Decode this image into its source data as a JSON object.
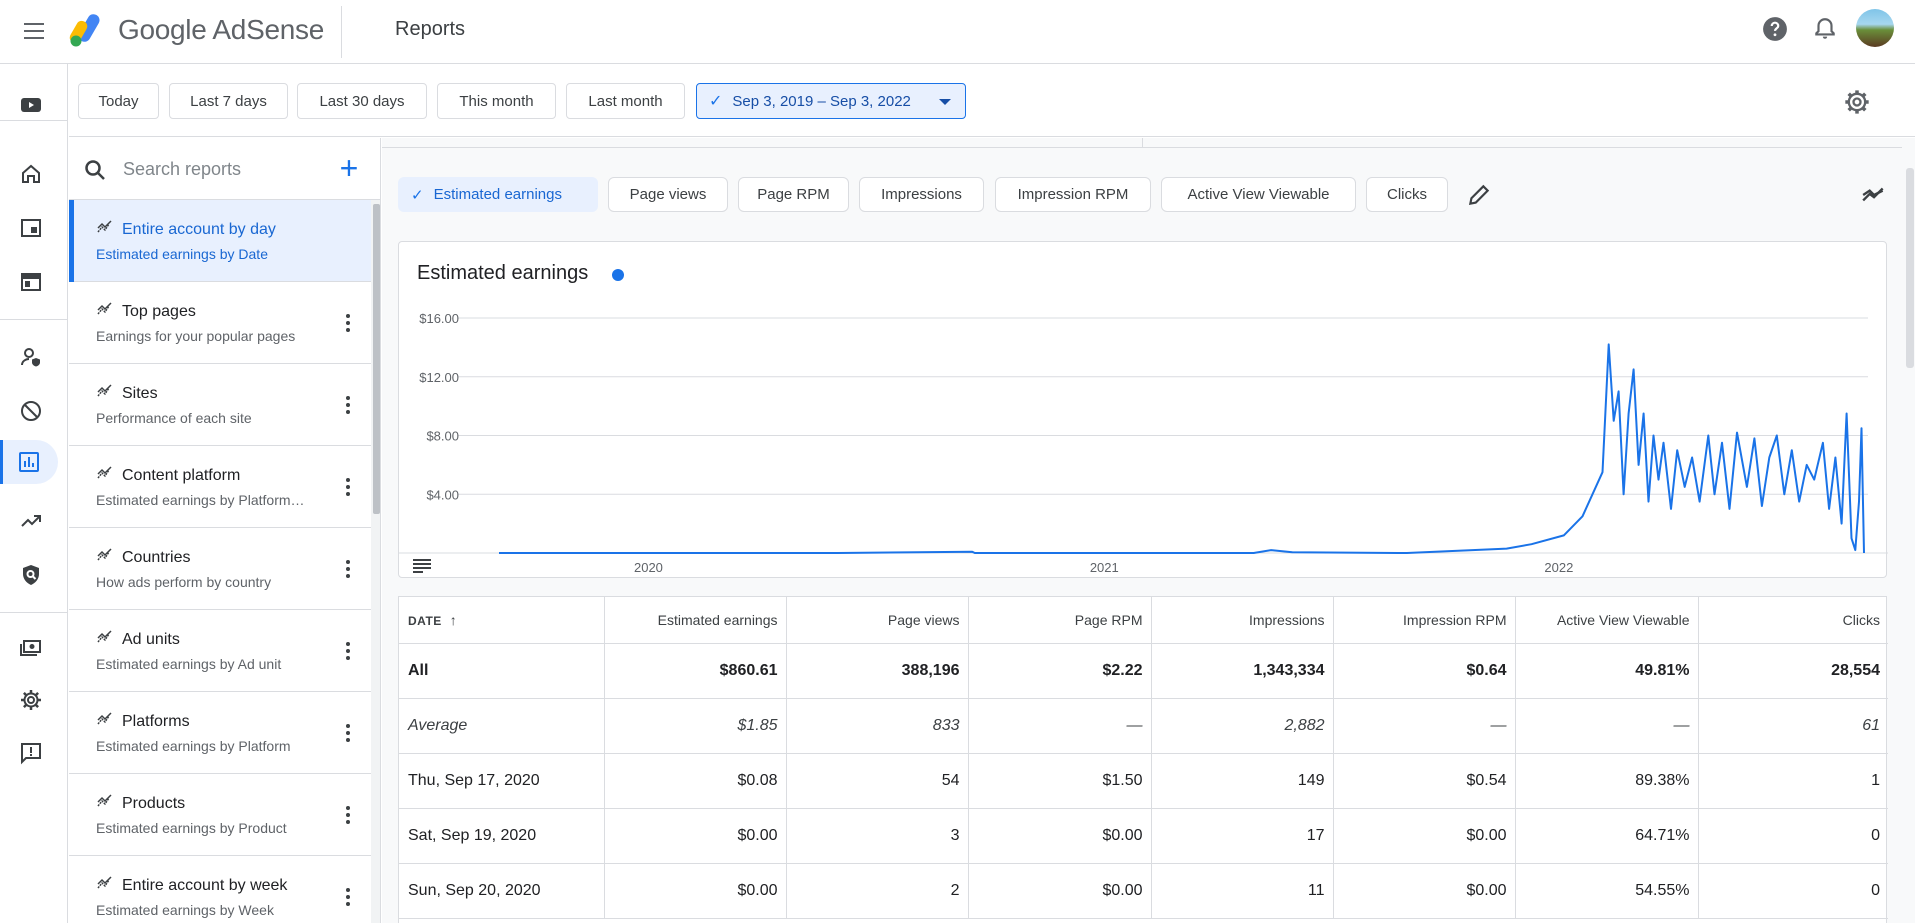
{
  "header": {
    "product": "Google AdSense",
    "page_title": "Reports"
  },
  "datebar": {
    "ranges": [
      "Today",
      "Last 7 days",
      "Last 30 days",
      "This month",
      "Last month"
    ],
    "selected_range": "Sep 3, 2019 – Sep 3, 2022"
  },
  "reports": {
    "search_placeholder": "Search reports",
    "items": [
      {
        "name": "Entire account by day",
        "desc": "Estimated earnings by Date"
      },
      {
        "name": "Top pages",
        "desc": "Earnings for your popular pages"
      },
      {
        "name": "Sites",
        "desc": "Performance of each site"
      },
      {
        "name": "Content platform",
        "desc": "Estimated earnings by Platform…"
      },
      {
        "name": "Countries",
        "desc": "How ads perform by country"
      },
      {
        "name": "Ad units",
        "desc": "Estimated earnings by Ad unit"
      },
      {
        "name": "Platforms",
        "desc": "Estimated earnings by Platform"
      },
      {
        "name": "Products",
        "desc": "Estimated earnings by Product"
      },
      {
        "name": "Entire account by week",
        "desc": "Estimated earnings by Week"
      }
    ]
  },
  "metrics": {
    "selected": "Estimated earnings",
    "others": [
      "Page views",
      "Page RPM",
      "Impressions",
      "Impression RPM",
      "Active View Viewable",
      "Clicks"
    ]
  },
  "chart": {
    "title": "Estimated earnings",
    "color": "#1a73e8"
  },
  "chart_data": {
    "type": "line",
    "title": "Estimated earnings",
    "x_start": "2019-09-03",
    "x_end": "2022-09-03",
    "xticks": [
      "2020",
      "2021",
      "2022"
    ],
    "yticks": [
      "$4.00",
      "$8.00",
      "$12.00",
      "$16.00"
    ],
    "ylim": [
      0,
      16
    ],
    "grid": true,
    "series": [
      {
        "name": "Estimated earnings",
        "points": [
          [
            "2019-09-03",
            0
          ],
          [
            "2020-06-01",
            0
          ],
          [
            "2020-09-17",
            0.08
          ],
          [
            "2020-09-19",
            0
          ],
          [
            "2021-05-01",
            0
          ],
          [
            "2021-05-15",
            0.2
          ],
          [
            "2021-06-01",
            0.05
          ],
          [
            "2021-09-01",
            0
          ],
          [
            "2021-11-20",
            0.3
          ],
          [
            "2021-12-10",
            0.6
          ],
          [
            "2022-01-05",
            1.2
          ],
          [
            "2022-01-20",
            2.5
          ],
          [
            "2022-02-05",
            5.5
          ],
          [
            "2022-02-10",
            14.2
          ],
          [
            "2022-02-14",
            9.0
          ],
          [
            "2022-02-18",
            11.0
          ],
          [
            "2022-02-22",
            4.0
          ],
          [
            "2022-02-26",
            9.5
          ],
          [
            "2022-03-02",
            12.5
          ],
          [
            "2022-03-06",
            6.0
          ],
          [
            "2022-03-10",
            9.5
          ],
          [
            "2022-03-14",
            3.5
          ],
          [
            "2022-03-18",
            8.0
          ],
          [
            "2022-03-22",
            5.0
          ],
          [
            "2022-03-26",
            7.5
          ],
          [
            "2022-04-01",
            3.0
          ],
          [
            "2022-04-06",
            7.0
          ],
          [
            "2022-04-12",
            4.5
          ],
          [
            "2022-04-18",
            6.5
          ],
          [
            "2022-04-24",
            3.5
          ],
          [
            "2022-05-01",
            8.0
          ],
          [
            "2022-05-06",
            4.0
          ],
          [
            "2022-05-12",
            7.5
          ],
          [
            "2022-05-18",
            3.0
          ],
          [
            "2022-05-24",
            8.2
          ],
          [
            "2022-06-01",
            4.5
          ],
          [
            "2022-06-07",
            7.8
          ],
          [
            "2022-06-13",
            3.2
          ],
          [
            "2022-06-19",
            6.5
          ],
          [
            "2022-06-25",
            8.0
          ],
          [
            "2022-07-01",
            4.0
          ],
          [
            "2022-07-07",
            7.0
          ],
          [
            "2022-07-13",
            3.5
          ],
          [
            "2022-07-19",
            6.0
          ],
          [
            "2022-07-25",
            5.0
          ],
          [
            "2022-08-01",
            7.5
          ],
          [
            "2022-08-06",
            3.0
          ],
          [
            "2022-08-11",
            6.5
          ],
          [
            "2022-08-16",
            2.0
          ],
          [
            "2022-08-20",
            9.5
          ],
          [
            "2022-08-24",
            1.0
          ],
          [
            "2022-08-27",
            0.2
          ],
          [
            "2022-08-30",
            3.5
          ],
          [
            "2022-09-01",
            8.5
          ],
          [
            "2022-09-03",
            0
          ]
        ]
      }
    ]
  },
  "table": {
    "headers": [
      "DATE",
      "Estimated earnings",
      "Page views",
      "Page RPM",
      "Impressions",
      "Impression RPM",
      "Active View Viewable",
      "Clicks"
    ],
    "total": [
      "All",
      "$860.61",
      "388,196",
      "$2.22",
      "1,343,334",
      "$0.64",
      "49.81%",
      "28,554"
    ],
    "average": [
      "Average",
      "$1.85",
      "833",
      "—",
      "2,882",
      "—",
      "—",
      "61"
    ],
    "rows": [
      [
        "Thu, Sep 17, 2020",
        "$0.08",
        "54",
        "$1.50",
        "149",
        "$0.54",
        "89.38%",
        "1"
      ],
      [
        "Sat, Sep 19, 2020",
        "$0.00",
        "3",
        "$0.00",
        "17",
        "$0.00",
        "64.71%",
        "0"
      ],
      [
        "Sun, Sep 20, 2020",
        "$0.00",
        "2",
        "$0.00",
        "11",
        "$0.00",
        "54.55%",
        "0"
      ]
    ]
  }
}
